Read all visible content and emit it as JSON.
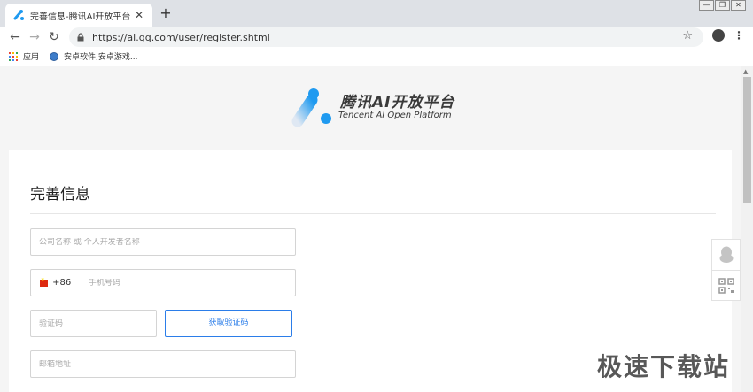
{
  "browser": {
    "tab_title": "完善信息-腾讯AI开放平台",
    "url": "https://ai.qq.com/user/register.shtml",
    "bookmarks": [
      {
        "label": "应用",
        "icon": "apps-icon"
      },
      {
        "label": "安卓软件,安卓游戏...",
        "icon": "globe-icon"
      }
    ]
  },
  "logo": {
    "title": "腾讯AI开放平台",
    "subtitle": "Tencent AI Open Platform",
    "accent": "#1f9af0"
  },
  "form": {
    "title": "完善信息",
    "company_placeholder": "公司名称 或 个人开发者名称",
    "phone_code": "+86",
    "phone_placeholder": "手机号码",
    "captcha_placeholder": "验证码",
    "get_code_label": "获取验证码",
    "email_placeholder": "邮箱地址"
  },
  "watermark": "极速下载站"
}
